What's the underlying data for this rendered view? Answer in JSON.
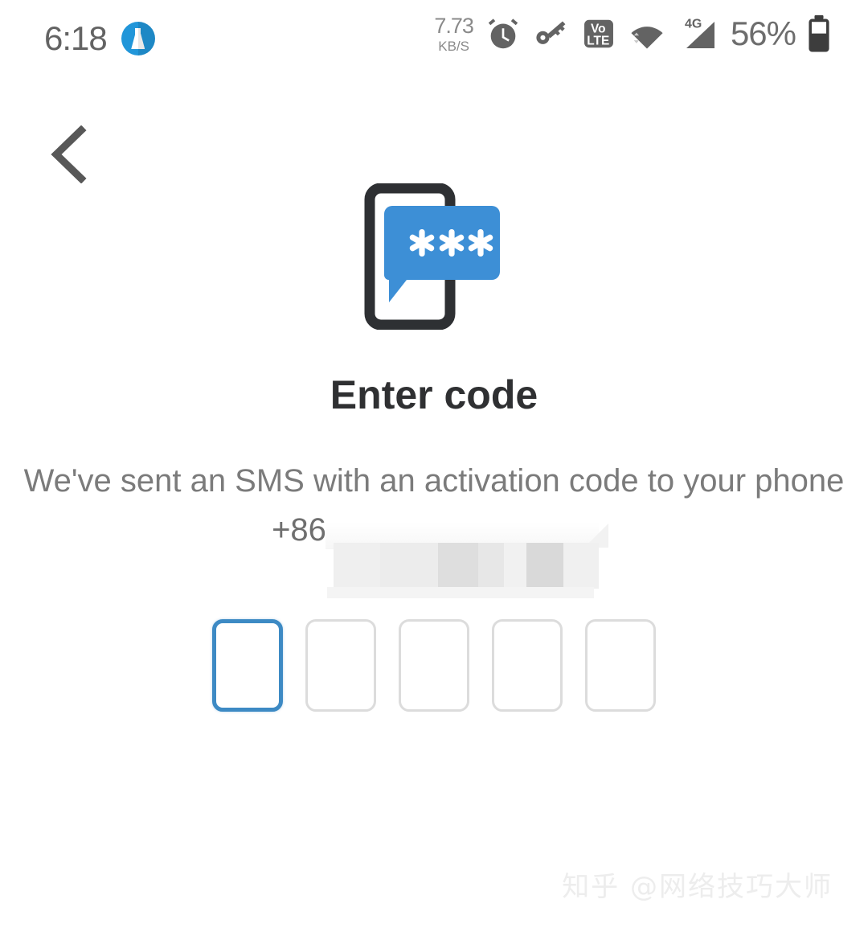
{
  "status_bar": {
    "time": "6:18",
    "app_badge_icon": "flask-icon",
    "network_speed_value": "7.73",
    "network_speed_unit": "KB/S",
    "alarm_icon": "alarm-clock-icon",
    "vpn_icon": "key-icon",
    "volte_icon": "volte-icon",
    "volte_top_label": "Vo",
    "volte_bottom_label": "LTE",
    "wifi_icon": "wifi-icon",
    "signal_icon": "signal-bars-icon",
    "signal_label": "4G",
    "battery_percent": "56%",
    "battery_icon": "battery-icon"
  },
  "nav": {
    "back_icon": "chevron-left-icon",
    "back_label": "Back"
  },
  "illustration": {
    "name": "sms-code-illustration",
    "phone_icon": "phone-outline-icon",
    "bubble_icon": "speech-bubble-icon",
    "bubble_text": "***",
    "phone_outline_color": "#2e3033",
    "bubble_color": "#3d8fd6"
  },
  "main": {
    "title": "Enter code",
    "description": "We've sent an SMS with an activation code to your phone",
    "phone_prefix": "+86",
    "phone_redacted": true
  },
  "otp": {
    "length": 5,
    "focused_index": 0,
    "accent_color": "#3d8ac4",
    "idle_border_color": "#dcdcdc",
    "boxes": [
      "",
      "",
      "",
      "",
      ""
    ]
  },
  "watermark": {
    "text": "知乎 @网络技巧大师"
  }
}
